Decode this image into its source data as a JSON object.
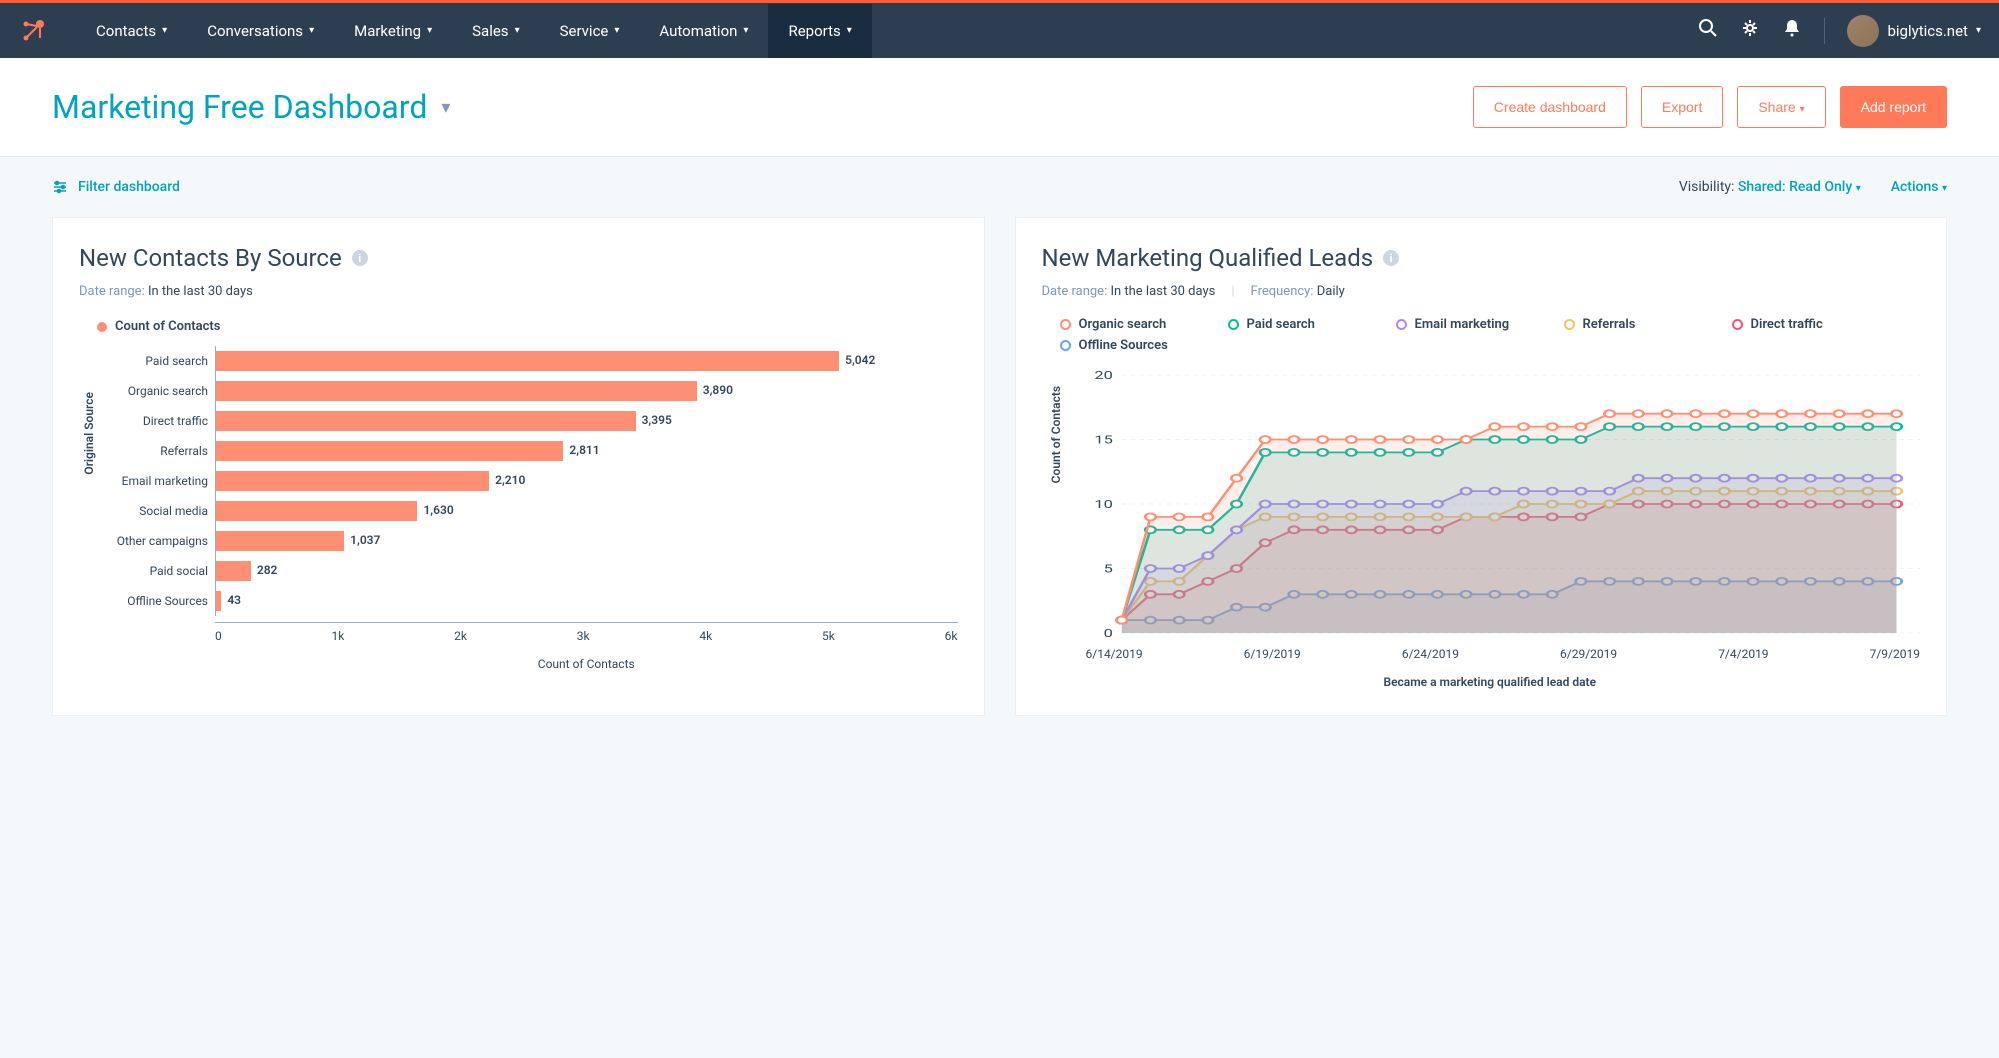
{
  "nav": {
    "items": [
      "Contacts",
      "Conversations",
      "Marketing",
      "Sales",
      "Service",
      "Automation",
      "Reports"
    ],
    "active_index": 6,
    "account": "biglytics.net"
  },
  "header": {
    "title": "Marketing Free Dashboard",
    "create": "Create dashboard",
    "export": "Export",
    "share": "Share",
    "add": "Add report"
  },
  "subheader": {
    "filter": "Filter dashboard",
    "visibility_label": "Visibility:",
    "visibility_value": "Shared: Read Only",
    "actions": "Actions"
  },
  "card1": {
    "title": "New Contacts By Source",
    "date_label": "Date range:",
    "date_value": "In the last 30 days",
    "legend": "Count of Contacts",
    "legend_color": "#ff8f73",
    "ylabel": "Original Source",
    "xlabel": "Count of Contacts"
  },
  "card2": {
    "title": "New Marketing Qualified Leads",
    "date_label": "Date range:",
    "date_value": "In the last 30 days",
    "freq_label": "Frequency:",
    "freq_value": "Daily",
    "ylabel": "Count of Contacts",
    "xlabel": "Became a marketing qualified lead date"
  },
  "chart_data": [
    {
      "type": "bar",
      "orientation": "horizontal",
      "title": "New Contacts By Source",
      "xlabel": "Count of Contacts",
      "ylabel": "Original Source",
      "categories": [
        "Paid search",
        "Organic search",
        "Direct traffic",
        "Referrals",
        "Email marketing",
        "Social media",
        "Other campaigns",
        "Paid social",
        "Offline Sources"
      ],
      "values": [
        5042,
        3890,
        3395,
        2811,
        2210,
        1630,
        1037,
        282,
        43
      ],
      "value_labels": [
        "5,042",
        "3,890",
        "3,395",
        "2,811",
        "2,210",
        "1,630",
        "1,037",
        "282",
        "43"
      ],
      "x_ticks": [
        "0",
        "1k",
        "2k",
        "3k",
        "4k",
        "5k",
        "6k"
      ],
      "xlim": [
        0,
        6000
      ],
      "color": "#ff8f73"
    },
    {
      "type": "line",
      "title": "New Marketing Qualified Leads",
      "xlabel": "Became a marketing qualified lead date",
      "ylabel": "Count of Contacts",
      "ylim": [
        0,
        20
      ],
      "y_ticks": [
        0,
        5,
        10,
        15,
        20
      ],
      "x_ticks": [
        "6/14/2019",
        "6/19/2019",
        "6/24/2019",
        "6/29/2019",
        "7/4/2019",
        "7/9/2019"
      ],
      "x": [
        "6/14",
        "6/15",
        "6/16",
        "6/17",
        "6/18",
        "6/19",
        "6/20",
        "6/21",
        "6/22",
        "6/23",
        "6/24",
        "6/25",
        "6/26",
        "6/27",
        "6/28",
        "6/29",
        "6/30",
        "7/1",
        "7/2",
        "7/3",
        "7/4",
        "7/5",
        "7/6",
        "7/7",
        "7/8",
        "7/9",
        "7/10",
        "7/11"
      ],
      "series": [
        {
          "name": "Organic search",
          "color": "#ff8f73",
          "values": [
            1,
            9,
            9,
            9,
            12,
            15,
            15,
            15,
            15,
            15,
            15,
            15,
            15,
            16,
            16,
            16,
            16,
            17,
            17,
            17,
            17,
            17,
            17,
            17,
            17,
            17,
            17,
            17
          ]
        },
        {
          "name": "Paid search",
          "color": "#00bda5",
          "values": [
            1,
            8,
            8,
            8,
            10,
            14,
            14,
            14,
            14,
            14,
            14,
            14,
            15,
            15,
            15,
            15,
            15,
            16,
            16,
            16,
            16,
            16,
            16,
            16,
            16,
            16,
            16,
            16
          ]
        },
        {
          "name": "Email marketing",
          "color": "#a78bfa",
          "values": [
            1,
            5,
            5,
            6,
            8,
            10,
            10,
            10,
            10,
            10,
            10,
            10,
            11,
            11,
            11,
            11,
            11,
            11,
            12,
            12,
            12,
            12,
            12,
            12,
            12,
            12,
            12,
            12
          ]
        },
        {
          "name": "Referrals",
          "color": "#f5c26b",
          "values": [
            1,
            4,
            4,
            6,
            8,
            9,
            9,
            9,
            9,
            9,
            9,
            9,
            9,
            9,
            10,
            10,
            10,
            10,
            11,
            11,
            11,
            11,
            11,
            11,
            11,
            11,
            11,
            11
          ]
        },
        {
          "name": "Direct traffic",
          "color": "#f2547d",
          "values": [
            1,
            3,
            3,
            4,
            5,
            7,
            8,
            8,
            8,
            8,
            8,
            8,
            9,
            9,
            9,
            9,
            9,
            10,
            10,
            10,
            10,
            10,
            10,
            10,
            10,
            10,
            10,
            10
          ]
        },
        {
          "name": "Offline Sources",
          "color": "#6ba4e7",
          "values": [
            1,
            1,
            1,
            1,
            2,
            2,
            3,
            3,
            3,
            3,
            3,
            3,
            3,
            3,
            3,
            3,
            4,
            4,
            4,
            4,
            4,
            4,
            4,
            4,
            4,
            4,
            4,
            4
          ]
        }
      ]
    }
  ]
}
